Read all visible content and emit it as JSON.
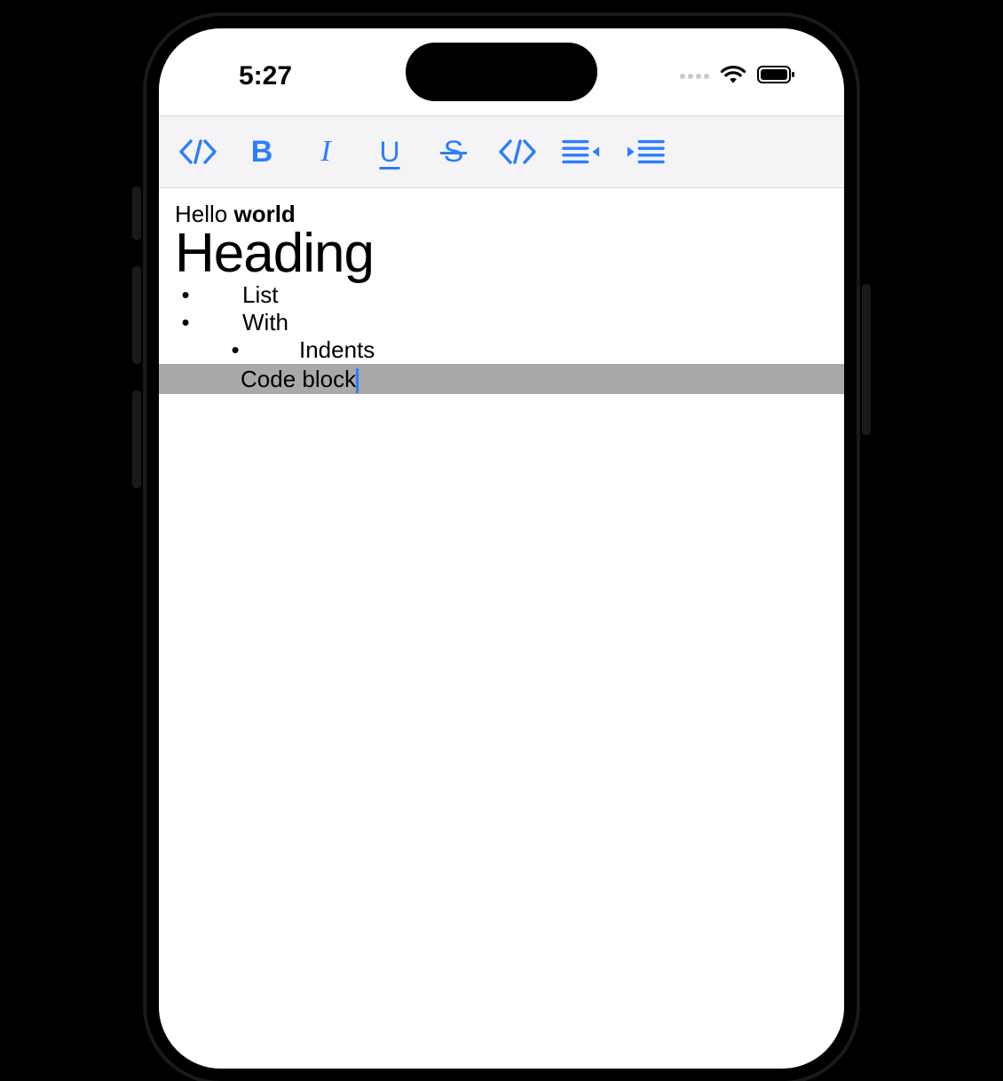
{
  "status": {
    "time": "5:27"
  },
  "toolbar": {
    "items": [
      {
        "name": "code-tag-icon"
      },
      {
        "name": "bold-icon"
      },
      {
        "name": "italic-icon"
      },
      {
        "name": "underline-icon"
      },
      {
        "name": "strikethrough-icon"
      },
      {
        "name": "code-tag-icon"
      },
      {
        "name": "outdent-icon"
      },
      {
        "name": "indent-icon"
      }
    ]
  },
  "editor": {
    "hello_prefix": "Hello ",
    "hello_bold": "world",
    "heading": "Heading",
    "list": {
      "item0": "List",
      "item1": "With",
      "item2": "Indents"
    },
    "code_block": "Code block"
  }
}
